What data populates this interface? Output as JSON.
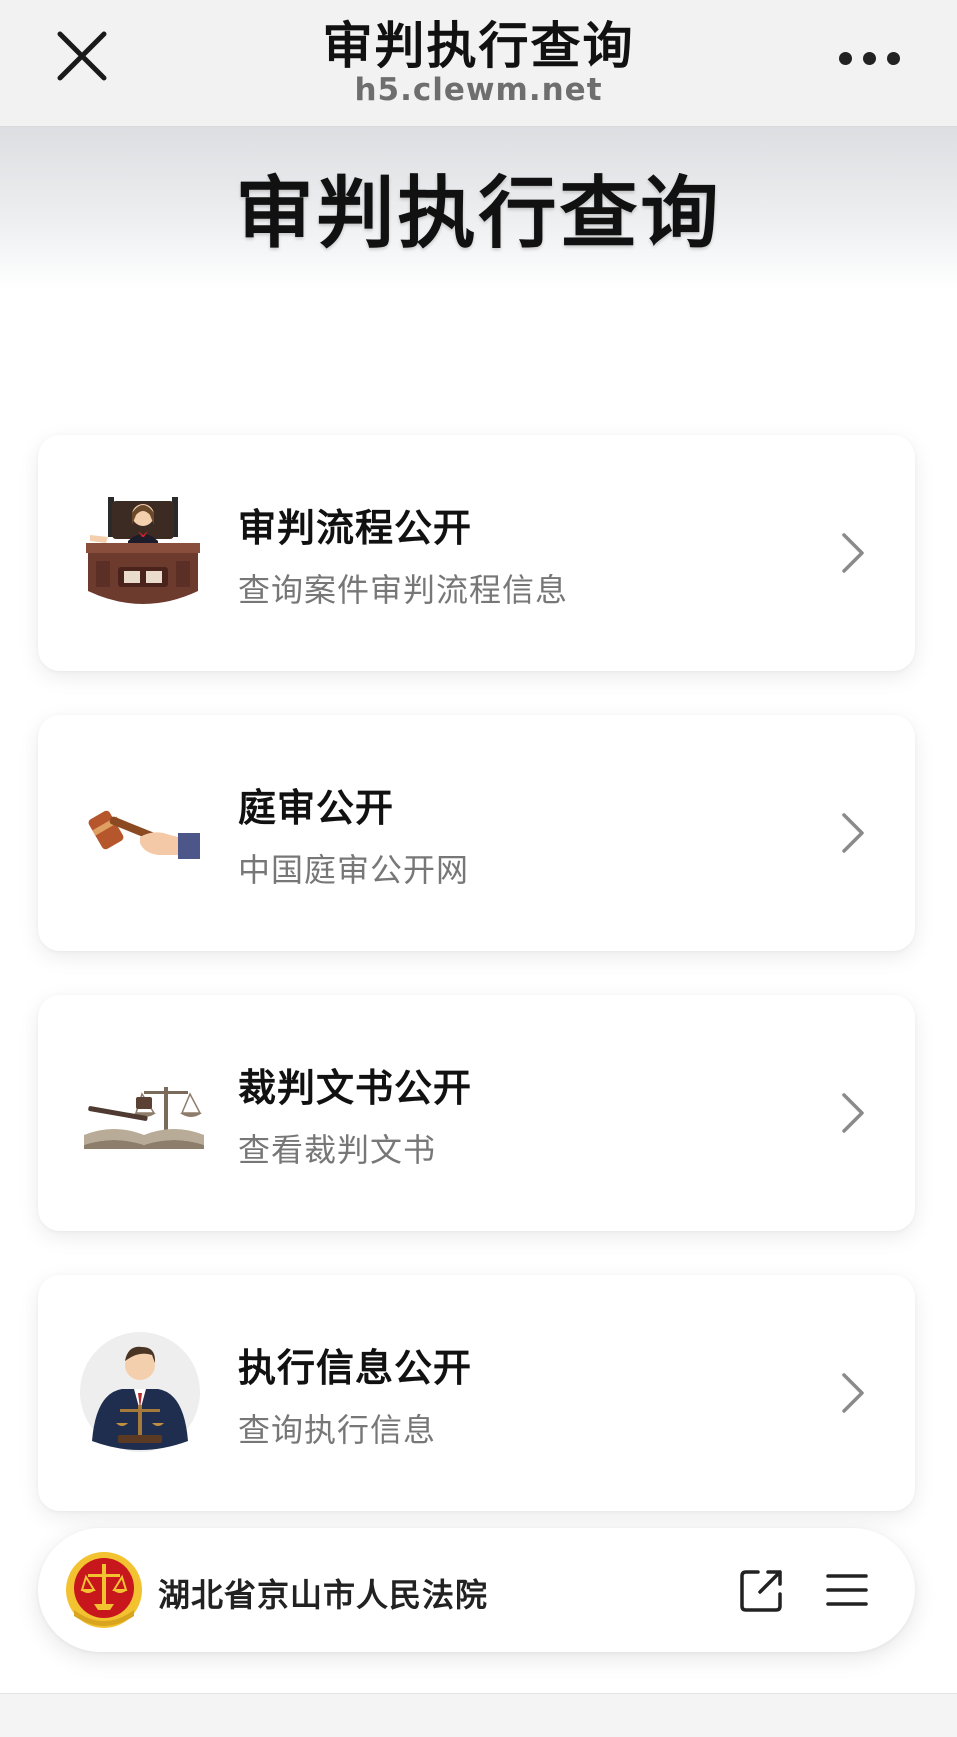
{
  "topbar": {
    "title": "审判执行查询",
    "url": "h5.clewm.net",
    "close_icon": "close-icon",
    "more_icon": "more-dots-icon"
  },
  "banner": {
    "title": "审判执行查询"
  },
  "cards": [
    {
      "title": "审判流程公开",
      "subtitle": "查询案件审判流程信息",
      "icon": "judge-bench-icon"
    },
    {
      "title": "庭审公开",
      "subtitle": "中国庭审公开网",
      "icon": "gavel-hand-icon"
    },
    {
      "title": "裁判文书公开",
      "subtitle": "查看裁判文书",
      "icon": "scales-book-icon"
    },
    {
      "title": "执行信息公开",
      "subtitle": "查询执行信息",
      "icon": "lawyer-scales-icon"
    }
  ],
  "footer": {
    "name": "湖北省京山市人民法院",
    "emblem_icon": "court-emblem-icon",
    "share_icon": "share-icon",
    "menu_icon": "menu-icon"
  },
  "colors": {
    "topbar_bg": "#f2f2f2",
    "url_text": "#6e6e6e",
    "subtitle_text": "#777777",
    "emblem_red": "#c8161d",
    "emblem_gold": "#f2c230"
  }
}
